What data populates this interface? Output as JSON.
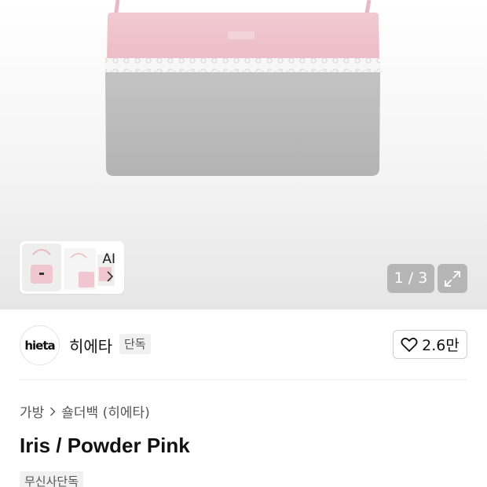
{
  "gallery": {
    "ai_card": {
      "label": "AI",
      "chevron_icon": "chevron-right-icon"
    },
    "page_indicator": "1 / 3",
    "expand_icon": "expand-icon"
  },
  "brand": {
    "logo_text": "hieta",
    "name": "히에타",
    "badge": "단독",
    "like_count": "2.6만",
    "like_icon": "heart-outline-icon"
  },
  "product": {
    "breadcrumb": [
      "가방",
      "숄더백 (히에타)"
    ],
    "title": "Iris / Powder Pink",
    "badge": "무신사단독"
  },
  "colors": {
    "bag_pink": "#efc3cc",
    "bag_gray": "#bcbcbc",
    "overlay": "#8a8a8a"
  }
}
